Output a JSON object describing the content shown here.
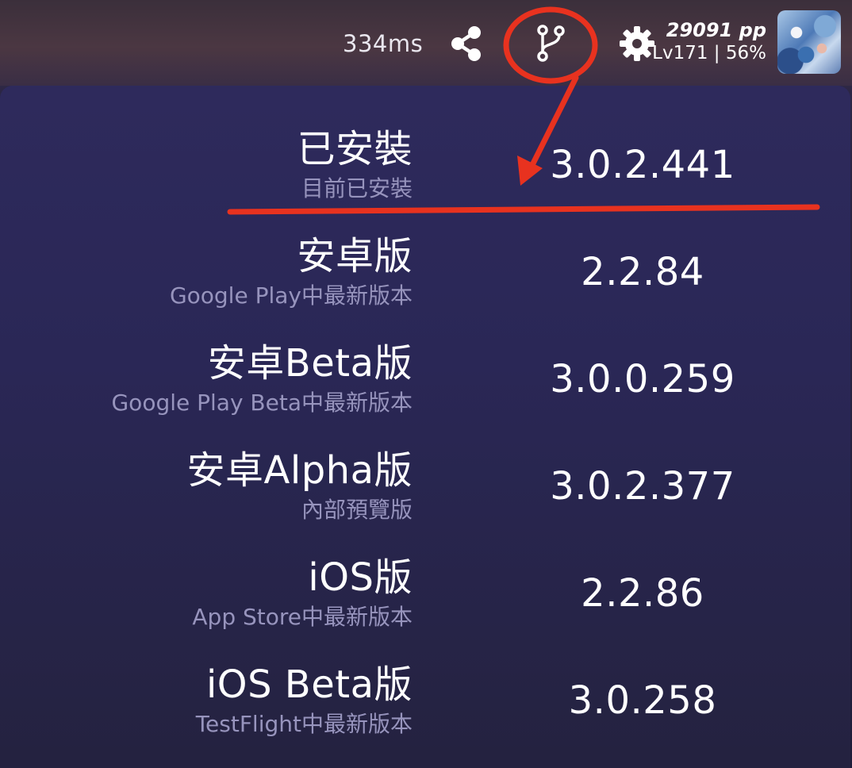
{
  "header": {
    "latency": "334ms",
    "pp": "29091 pp",
    "level": "Lv171 | 56%",
    "icons": [
      "share-icon",
      "branch-icon",
      "gear-icon"
    ]
  },
  "versions": [
    {
      "name": "已安裝",
      "description": "目前已安裝",
      "version": "3.0.2.441"
    },
    {
      "name": "安卓版",
      "description": "Google Play中最新版本",
      "version": "2.2.84"
    },
    {
      "name": "安卓Beta版",
      "description": "Google Play Beta中最新版本",
      "version": "3.0.0.259"
    },
    {
      "name": "安卓Alpha版",
      "description": "內部預覽版",
      "version": "3.0.2.377"
    },
    {
      "name": "iOS版",
      "description": "App Store中最新版本",
      "version": "2.2.86"
    },
    {
      "name": "iOS Beta版",
      "description": "TestFlight中最新版本",
      "version": "3.0.258"
    }
  ],
  "colors": {
    "annotation": "#e8321f",
    "panel": "#2a2756",
    "subtitle": "#9794bd"
  }
}
